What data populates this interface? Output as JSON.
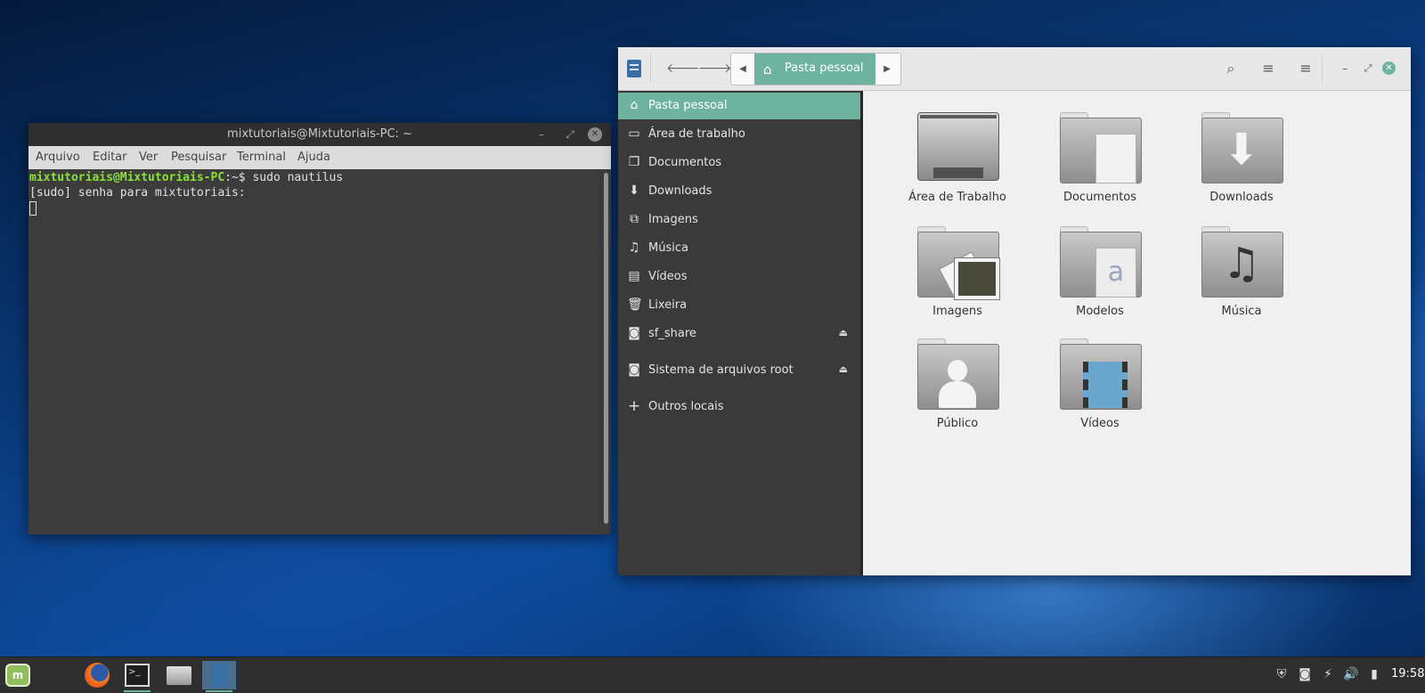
{
  "terminal": {
    "title": "mixtutoriais@Mixtutoriais-PC: ~",
    "menu": [
      "Arquivo",
      "Editar",
      "Ver",
      "Pesquisar",
      "Terminal",
      "Ajuda"
    ],
    "prompt_user": "mixtutoriais@Mixtutoriais-PC",
    "prompt_path": ":~$",
    "command": " sudo nautilus",
    "output_line": "[sudo] senha para mixtutoriais:"
  },
  "file_manager": {
    "path_label": "Pasta pessoal",
    "sidebar": [
      {
        "label": "Pasta pessoal",
        "icon": "home-icon",
        "active": true
      },
      {
        "label": "Área de trabalho",
        "icon": "desktop-icon"
      },
      {
        "label": "Documentos",
        "icon": "documents-icon"
      },
      {
        "label": "Downloads",
        "icon": "download-icon"
      },
      {
        "label": "Imagens",
        "icon": "pictures-icon"
      },
      {
        "label": "Música",
        "icon": "music-icon"
      },
      {
        "label": "Vídeos",
        "icon": "videos-icon"
      },
      {
        "label": "Lixeira",
        "icon": "trash-icon"
      },
      {
        "label": "sf_share",
        "icon": "drive-icon",
        "ejectable": true
      },
      {
        "label": "Sistema de arquivos root",
        "icon": "drive-icon",
        "ejectable": true
      },
      {
        "label": "Outros locais",
        "icon": "plus-icon"
      }
    ],
    "folders": [
      {
        "label": "Área de Trabalho",
        "icon": "desktop-folder-icon"
      },
      {
        "label": "Documentos",
        "icon": "document-folder-icon"
      },
      {
        "label": "Downloads",
        "icon": "download-folder-icon"
      },
      {
        "label": "Imagens",
        "icon": "pictures-folder-icon"
      },
      {
        "label": "Modelos",
        "icon": "templates-folder-icon"
      },
      {
        "label": "Música",
        "icon": "music-folder-icon"
      },
      {
        "label": "Público",
        "icon": "public-folder-icon"
      },
      {
        "label": "Vídeos",
        "icon": "videos-folder-icon"
      }
    ]
  },
  "taskbar": {
    "clock": "19:58",
    "apps": [
      "mint-menu-icon",
      "firefox-icon",
      "terminal-icon",
      "files-icon",
      "file-manager-icon"
    ],
    "tray": [
      "shield-icon",
      "drive-icon",
      "network-icon",
      "volume-icon",
      "battery-icon"
    ]
  },
  "colors": {
    "accent": "#6db3a0",
    "prompt_green": "#8ae234"
  }
}
